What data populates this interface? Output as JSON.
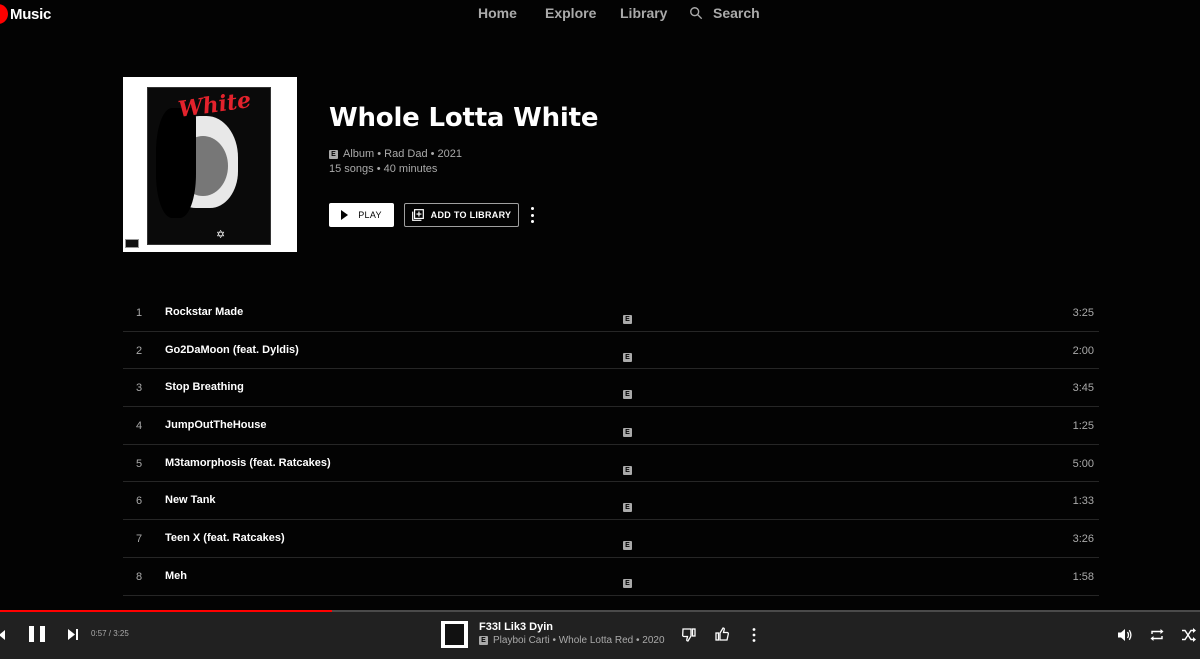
{
  "app": {
    "logo_text": "Music"
  },
  "nav": {
    "home": "Home",
    "explore": "Explore",
    "library": "Library",
    "search": "Search"
  },
  "album": {
    "title": "Whole Lotta White",
    "cover_text": "White",
    "explicit_badge": "E",
    "meta_line1": "Album • Rad Dad • 2021",
    "meta_line2": "15 songs • 40 minutes",
    "play_label": "PLAY",
    "add_label": "ADD TO LIBRARY"
  },
  "tracks": [
    {
      "num": "1",
      "title": "Rockstar Made",
      "explicit": "E",
      "duration": "3:25"
    },
    {
      "num": "2",
      "title": "Go2DaMoon (feat. Dyldis)",
      "explicit": "E",
      "duration": "2:00"
    },
    {
      "num": "3",
      "title": "Stop Breathing",
      "explicit": "E",
      "duration": "3:45"
    },
    {
      "num": "4",
      "title": "JumpOutTheHouse",
      "explicit": "E",
      "duration": "1:25"
    },
    {
      "num": "5",
      "title": "M3tamorphosis (feat. Ratcakes)",
      "explicit": "E",
      "duration": "5:00"
    },
    {
      "num": "6",
      "title": "New Tank",
      "explicit": "E",
      "duration": "1:33"
    },
    {
      "num": "7",
      "title": "Teen X (feat. Ratcakes)",
      "explicit": "E",
      "duration": "3:26"
    },
    {
      "num": "8",
      "title": "Meh",
      "explicit": "E",
      "duration": "1:58"
    }
  ],
  "player": {
    "time": "0:57 / 3:25",
    "progress_fraction": 0.277,
    "track_title": "F33l Lik3 Dyin",
    "explicit_badge": "E",
    "track_sub": "Playboi Carti • Whole Lotta Red • 2020"
  },
  "colors": {
    "accent": "#ff0000",
    "background": "#030303",
    "player_bg": "#212121",
    "muted_text": "#aaaaaa"
  }
}
